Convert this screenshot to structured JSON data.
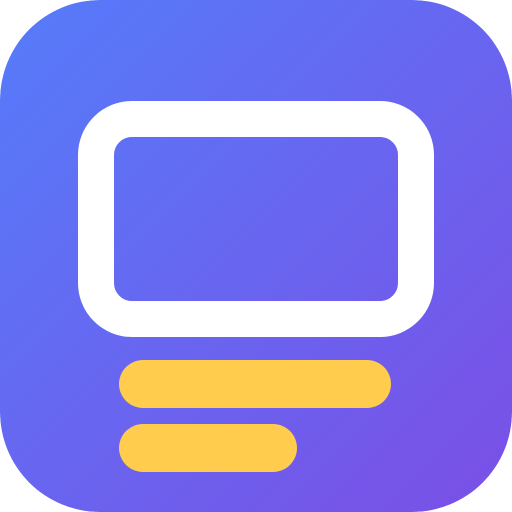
{
  "icon": {
    "semantic": "monitor-with-lines-icon",
    "colors": {
      "gradient_start": "#557CFA",
      "gradient_end": "#7B4FE6",
      "screen_frame": "#FFFFFF",
      "lines": "#FFCC4D"
    }
  }
}
